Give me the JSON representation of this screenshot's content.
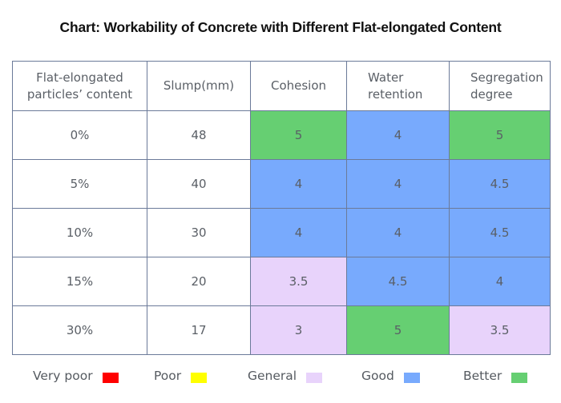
{
  "chart_data": {
    "type": "table",
    "title": "Chart: Workability of Concrete with Different Flat-elongated Content",
    "columns": [
      "Flat-elongated particles’ content",
      "Slump(mm)",
      "Cohesion",
      "Water retention",
      "Segregation degree"
    ],
    "header_lines": [
      [
        "Flat-elongated",
        "particles’ content"
      ],
      [
        "Slump(mm)"
      ],
      [
        "Cohesion"
      ],
      [
        "Water",
        "retention"
      ],
      [
        "Segregation",
        "degree"
      ]
    ],
    "rows": [
      {
        "content": "0%",
        "slump": "48",
        "cohesion": "5",
        "water_retention": "4",
        "segregation": "5"
      },
      {
        "content": "5%",
        "slump": "40",
        "cohesion": "4",
        "water_retention": "4",
        "segregation": "4.5"
      },
      {
        "content": "10%",
        "slump": "30",
        "cohesion": "4",
        "water_retention": "4",
        "segregation": "4.5"
      },
      {
        "content": "15%",
        "slump": "20",
        "cohesion": "3.5",
        "water_retention": "4.5",
        "segregation": "4"
      },
      {
        "content": "30%",
        "slump": "17",
        "cohesion": "3",
        "water_retention": "5",
        "segregation": "3.5"
      }
    ],
    "ratings": [
      [
        "better",
        "good",
        "better"
      ],
      [
        "good",
        "good",
        "good"
      ],
      [
        "good",
        "good",
        "good"
      ],
      [
        "general",
        "good",
        "good"
      ],
      [
        "general",
        "better",
        "general"
      ]
    ],
    "legend": [
      {
        "key": "very_poor",
        "label": "Very poor",
        "color": "#ff0000"
      },
      {
        "key": "poor",
        "label": "Poor",
        "color": "#ffff00"
      },
      {
        "key": "general",
        "label": "General",
        "color": "#e8d3fb"
      },
      {
        "key": "good",
        "label": "Good",
        "color": "#78aafd"
      },
      {
        "key": "better",
        "label": "Better",
        "color": "#66cf72"
      }
    ]
  }
}
